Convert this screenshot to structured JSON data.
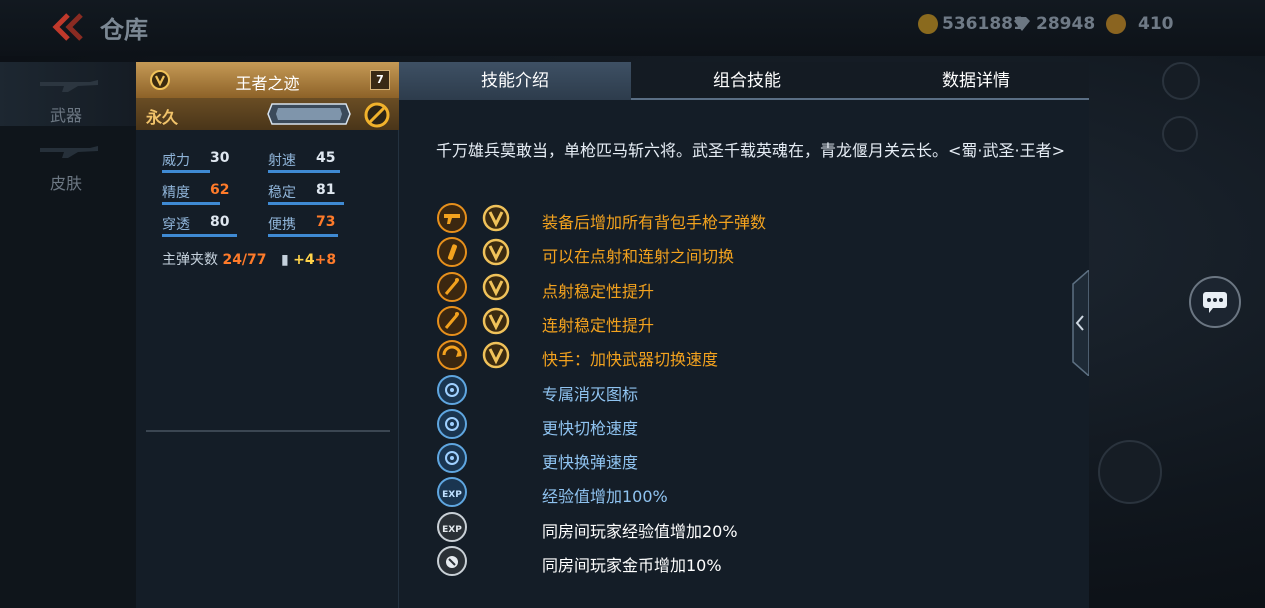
{
  "header": {
    "title": "仓库",
    "currency": {
      "gold": "5361881",
      "diamond": "28948",
      "points": "410"
    }
  },
  "sidebar": {
    "items": [
      {
        "label": "武器"
      },
      {
        "label": "皮肤"
      }
    ]
  },
  "weapon": {
    "name": "王者之迹",
    "level": "7",
    "duration": "永久",
    "stats": [
      {
        "label": "威力",
        "value": "30",
        "highlight": false,
        "fill": 0.48
      },
      {
        "label": "射速",
        "value": "45",
        "highlight": false,
        "fill": 0.72
      },
      {
        "label": "精度",
        "value": "62",
        "highlight": true,
        "fill": 0.58
      },
      {
        "label": "稳定",
        "value": "81",
        "highlight": false,
        "fill": 0.76
      },
      {
        "label": "穿透",
        "value": "80",
        "highlight": false,
        "fill": 0.75
      },
      {
        "label": "便携",
        "value": "73",
        "highlight": true,
        "fill": 0.7
      }
    ],
    "ammo": {
      "label": "主弹夹数",
      "value": "24/77",
      "bonus1": "+4",
      "bonus2": "+8"
    }
  },
  "tabs": [
    {
      "label": "技能介绍"
    },
    {
      "label": "组合技能"
    },
    {
      "label": "数据详情"
    }
  ],
  "description": "千万雄兵莫敢当，单枪匹马斩六将。武圣千载英魂在，青龙偃月关云长。<蜀·武圣·王者>",
  "skills": [
    {
      "text": "装备后增加所有背包手枪子弹数",
      "icon": "pistol-icon",
      "vip": true,
      "color": "#f3a21e"
    },
    {
      "text": "可以在点射和连射之间切换",
      "icon": "bullet-icon",
      "vip": true,
      "color": "#f3a21e"
    },
    {
      "text": "点射稳定性提升",
      "icon": "stability-icon",
      "vip": true,
      "color": "#f3a21e"
    },
    {
      "text": "连射稳定性提升",
      "icon": "stability-icon",
      "vip": true,
      "color": "#f3a21e"
    },
    {
      "text": "快手：加快武器切换速度",
      "icon": "quick-switch-icon",
      "vip": true,
      "color": "#f3a21e"
    },
    {
      "text": "专属消灭图标",
      "icon": "kill-mark-icon",
      "vip": false,
      "color": "#8fc3f0"
    },
    {
      "text": "更快切枪速度",
      "icon": "switch-speed-icon",
      "vip": false,
      "color": "#8fc3f0"
    },
    {
      "text": "更快换弹速度",
      "icon": "reload-speed-icon",
      "vip": false,
      "color": "#8fc3f0"
    },
    {
      "text": "经验值增加100%",
      "icon": "exp-icon",
      "vip": false,
      "color": "#8fc3f0"
    },
    {
      "text": "同房间玩家经验值增加20%",
      "icon": "room-exp-icon",
      "vip": false,
      "color": "#ffffff"
    },
    {
      "text": "同房间玩家金币增加10%",
      "icon": "room-coin-icon",
      "vip": false,
      "color": "#ffffff"
    }
  ]
}
